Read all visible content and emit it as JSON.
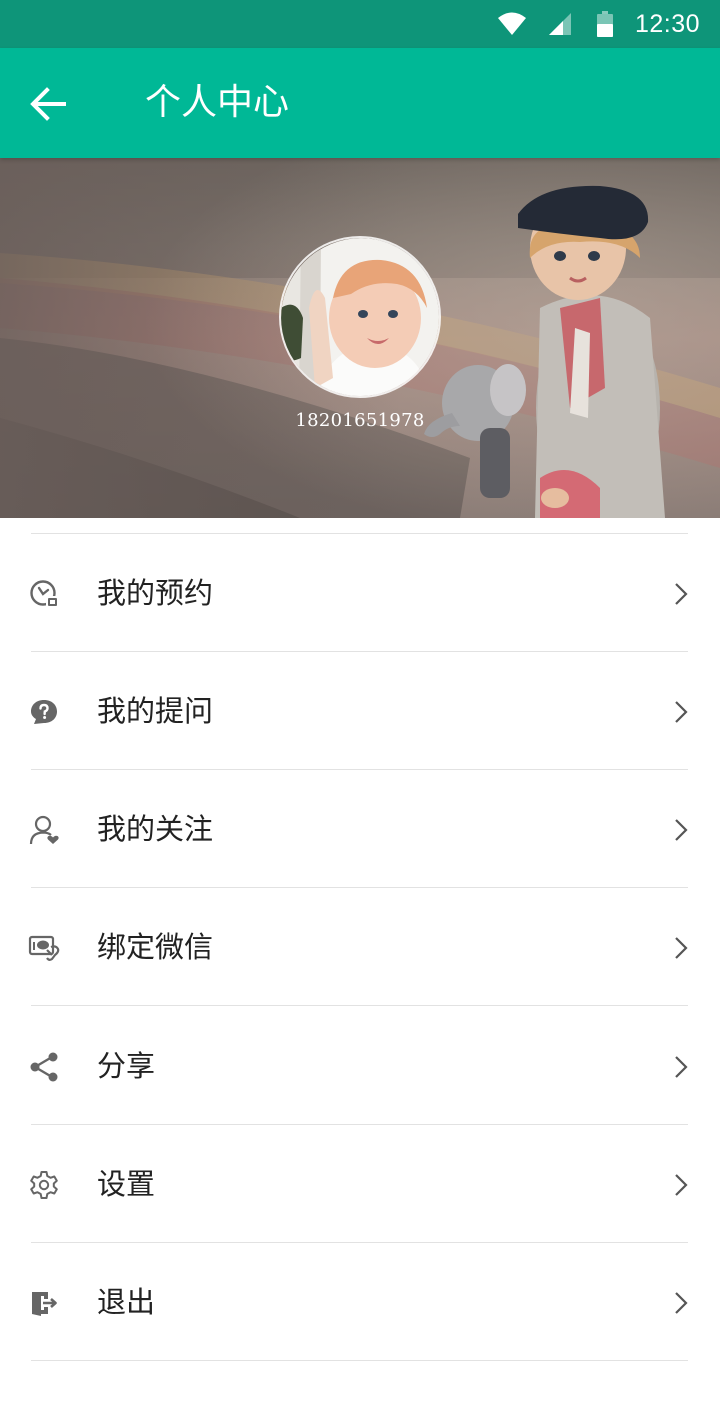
{
  "status_bar": {
    "time": "12:30",
    "icons": [
      "wifi-icon",
      "signal-icon",
      "battery-icon"
    ]
  },
  "app_bar": {
    "title": "个人中心",
    "back_icon": "arrow-left-icon"
  },
  "profile": {
    "phone": "18201651978"
  },
  "menu": [
    {
      "label": "我的预约",
      "icon": "appointment-clock-icon"
    },
    {
      "label": "我的提问",
      "icon": "question-bubble-icon"
    },
    {
      "label": "我的关注",
      "icon": "user-heart-icon"
    },
    {
      "label": "绑定微信",
      "icon": "wechat-link-icon"
    },
    {
      "label": "分享",
      "icon": "share-icon"
    },
    {
      "label": "设置",
      "icon": "gear-icon"
    },
    {
      "label": "退出",
      "icon": "logout-icon"
    }
  ],
  "colors": {
    "status_bar": "#0e9579",
    "app_bar": "#00b896",
    "divider": "#e2e2e2",
    "icon": "#666666",
    "text": "#222222"
  }
}
